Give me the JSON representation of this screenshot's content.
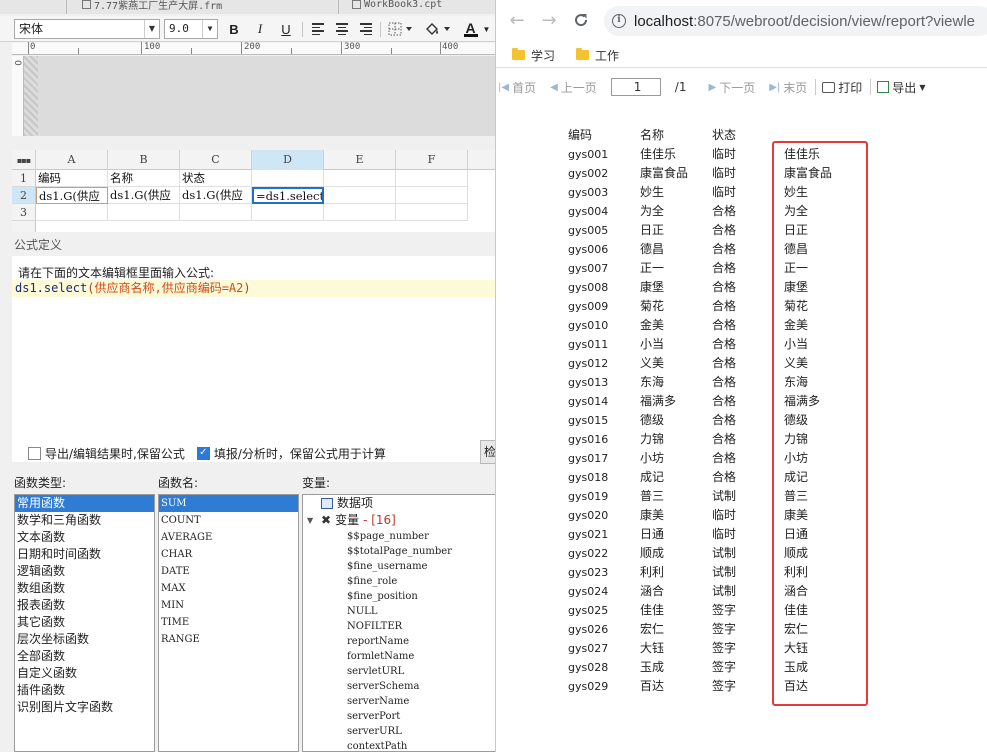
{
  "designer": {
    "tabs": [
      {
        "label": "7.77紫燕工厂生产大屏.frm"
      },
      {
        "label": "WorkBook3.cpt"
      }
    ],
    "format_bar": {
      "font_family": "宋体",
      "font_size": "9.0",
      "bold_label": "B",
      "italic_label": "I",
      "underline_label": "U",
      "font_color_label": "A"
    },
    "ruler": {
      "marks": [
        "0",
        "100",
        "200",
        "300",
        "400"
      ],
      "vertical_mark": "0"
    },
    "grid": {
      "columns": [
        "A",
        "B",
        "C",
        "D",
        "E",
        "F"
      ],
      "rows": [
        "1",
        "2",
        "3"
      ],
      "cells": {
        "A1": "编码",
        "B1": "名称",
        "C1": "状态",
        "A2": "ds1.G(供应",
        "B2": "ds1.G(供应",
        "C2": "ds1.G(供应",
        "D2": "=ds1.select"
      }
    },
    "formula_dialog": {
      "title": "公式定义",
      "hint": "请在下面的文本编辑框里面输入公式:",
      "formula": {
        "fn": "ds1.select",
        "open": "(",
        "args": "供应商名称,供应商编码=A2",
        "close": ")"
      },
      "option_export": "导出/编辑结果时,保留公式",
      "option_fill": "填报/分析时，保留公式用于计算",
      "option_export_checked": false,
      "option_fill_checked": true,
      "check_button": "检",
      "func_type_title": "函数类型:",
      "func_types": [
        "常用函数",
        "数学和三角函数",
        "文本函数",
        "日期和时间函数",
        "逻辑函数",
        "数组函数",
        "报表函数",
        "其它函数",
        "层次坐标函数",
        "全部函数",
        "自定义函数",
        "插件函数",
        "识别图片文字函数"
      ],
      "func_name_title": "函数名:",
      "func_names": [
        "SUM",
        "COUNT",
        "AVERAGE",
        "CHAR",
        "DATE",
        "MAX",
        "MIN",
        "TIME",
        "RANGE"
      ],
      "var_title": "变量:",
      "var_node_data": "数据项",
      "var_node_vars": "变量",
      "var_node_count": "- [16]",
      "variables": [
        "$$page_number",
        "$$totalPage_number",
        "$fine_username",
        "$fine_role",
        "$fine_position",
        "NULL",
        "NOFILTER",
        "reportName",
        "formletName",
        "servletURL",
        "serverSchema",
        "serverName",
        "serverPort",
        "serverURL",
        "contextPath"
      ]
    }
  },
  "browser": {
    "url_host": "localhost",
    "url_path": ":8075/webroot/decision/view/report?viewle",
    "bookmarks": [
      "学习",
      "工作"
    ],
    "report_toolbar": {
      "first": "首页",
      "prev": "上一页",
      "page_value": "1",
      "page_total": "/1",
      "next": "下一页",
      "last": "末页",
      "print": "打印",
      "export": "导出"
    },
    "report": {
      "headers": [
        "编码",
        "名称",
        "状态"
      ],
      "rows": [
        {
          "code": "gys001",
          "name": "佳佳乐",
          "status": "临时",
          "d": "佳佳乐"
        },
        {
          "code": "gys002",
          "name": "康富食品",
          "status": "临时",
          "d": "康富食品"
        },
        {
          "code": "gys003",
          "name": "妙生",
          "status": "临时",
          "d": "妙生"
        },
        {
          "code": "gys004",
          "name": "为全",
          "status": "合格",
          "d": "为全"
        },
        {
          "code": "gys005",
          "name": "日正",
          "status": "合格",
          "d": "日正"
        },
        {
          "code": "gys006",
          "name": "德昌",
          "status": "合格",
          "d": "德昌"
        },
        {
          "code": "gys007",
          "name": "正一",
          "status": "合格",
          "d": "正一"
        },
        {
          "code": "gys008",
          "name": "康堡",
          "status": "合格",
          "d": "康堡"
        },
        {
          "code": "gys009",
          "name": "菊花",
          "status": "合格",
          "d": "菊花"
        },
        {
          "code": "gys010",
          "name": "金美",
          "status": "合格",
          "d": "金美"
        },
        {
          "code": "gys011",
          "name": "小当",
          "status": "合格",
          "d": "小当"
        },
        {
          "code": "gys012",
          "name": "义美",
          "status": "合格",
          "d": "义美"
        },
        {
          "code": "gys013",
          "name": "东海",
          "status": "合格",
          "d": "东海"
        },
        {
          "code": "gys014",
          "name": "福满多",
          "status": "合格",
          "d": "福满多"
        },
        {
          "code": "gys015",
          "name": "德级",
          "status": "合格",
          "d": "德级"
        },
        {
          "code": "gys016",
          "name": "力锦",
          "status": "合格",
          "d": "力锦"
        },
        {
          "code": "gys017",
          "name": "小坊",
          "status": "合格",
          "d": "小坊"
        },
        {
          "code": "gys018",
          "name": "成记",
          "status": "合格",
          "d": "成记"
        },
        {
          "code": "gys019",
          "name": "普三",
          "status": "试制",
          "d": "普三"
        },
        {
          "code": "gys020",
          "name": "康美",
          "status": "临时",
          "d": "康美"
        },
        {
          "code": "gys021",
          "name": "日通",
          "status": "临时",
          "d": "日通"
        },
        {
          "code": "gys022",
          "name": "顺成",
          "status": "试制",
          "d": "顺成"
        },
        {
          "code": "gys023",
          "name": "利利",
          "status": "试制",
          "d": "利利"
        },
        {
          "code": "gys024",
          "name": "涵合",
          "status": "试制",
          "d": "涵合"
        },
        {
          "code": "gys025",
          "name": "佳佳",
          "status": "签字",
          "d": "佳佳"
        },
        {
          "code": "gys026",
          "name": "宏仁",
          "status": "签字",
          "d": "宏仁"
        },
        {
          "code": "gys027",
          "name": "大钰",
          "status": "签字",
          "d": "大钰"
        },
        {
          "code": "gys028",
          "name": "玉成",
          "status": "签字",
          "d": "玉成"
        },
        {
          "code": "gys029",
          "name": "百达",
          "status": "签字",
          "d": "百达"
        }
      ]
    }
  },
  "colors": {
    "highlight_box": "#e23b3b",
    "selection": "#2f7cd5",
    "accent_blue": "#1f6fd1"
  }
}
